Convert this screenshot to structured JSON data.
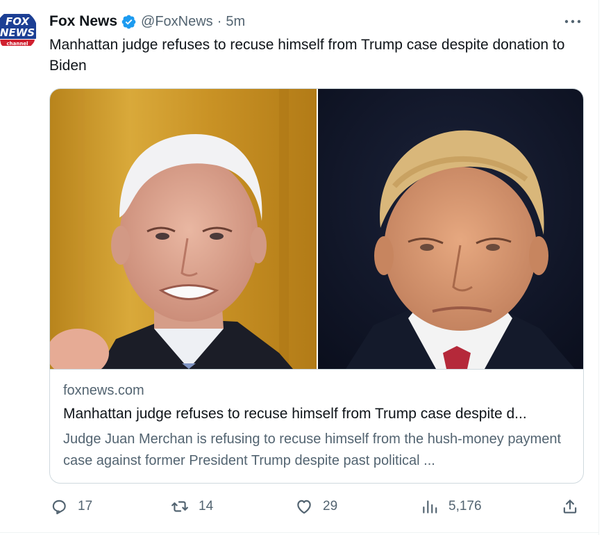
{
  "tweet": {
    "author_name": "Fox News",
    "handle": "@FoxNews",
    "separator": "·",
    "time": "5m",
    "text": "Manhattan judge refuses to recuse himself from Trump case despite donation to Biden",
    "avatar": {
      "logo_text_top": "FOX",
      "logo_text_mid": "NEWS",
      "logo_text_bottom": "channel"
    }
  },
  "card": {
    "domain": "foxnews.com",
    "title": "Manhattan judge refuses to recuse himself from Trump case despite d...",
    "description": "Judge Juan Merchan is refusing to recuse himself from the hush-money payment case against former President Trump despite past political ..."
  },
  "actions": {
    "replies": "17",
    "retweets": "14",
    "likes": "29",
    "views": "5,176"
  },
  "colors": {
    "text_primary": "#0f1419",
    "text_secondary": "#536471",
    "verified_blue": "#1d9bf0",
    "border": "#cfd9de"
  },
  "icons": {
    "verified": "verified-badge-icon",
    "more": "more-dots-icon",
    "reply": "reply-icon",
    "retweet": "retweet-icon",
    "like": "heart-icon",
    "views": "views-chart-icon",
    "share": "share-icon"
  }
}
